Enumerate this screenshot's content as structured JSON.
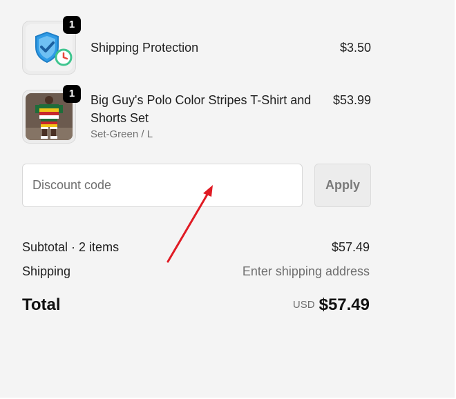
{
  "colors": {
    "background": "#f4f4f4",
    "badge": "#000000",
    "annotation_arrow": "#e01b24",
    "shield": "#2f9be6",
    "clock": "#3fc58f"
  },
  "items": [
    {
      "icon": "shipping-protection-shield-icon",
      "quantity": "1",
      "title": "Shipping Protection",
      "price": "$3.50"
    },
    {
      "icon": "polo-shirt-product-image",
      "quantity": "1",
      "title_line1": "Big Guy's Polo Color Stripes T-Shirt and",
      "title_line2": "Shorts Set",
      "variant": "Set-Green / L",
      "price": "$53.99"
    }
  ],
  "discount": {
    "placeholder": "Discount code",
    "value": "",
    "apply_label": "Apply"
  },
  "summary": {
    "subtotal_label": "Subtotal · 2 items",
    "subtotal_value": "$57.49",
    "shipping_label": "Shipping",
    "shipping_value": "Enter shipping address",
    "total_label": "Total",
    "currency": "USD",
    "total_value": "$57.49"
  }
}
